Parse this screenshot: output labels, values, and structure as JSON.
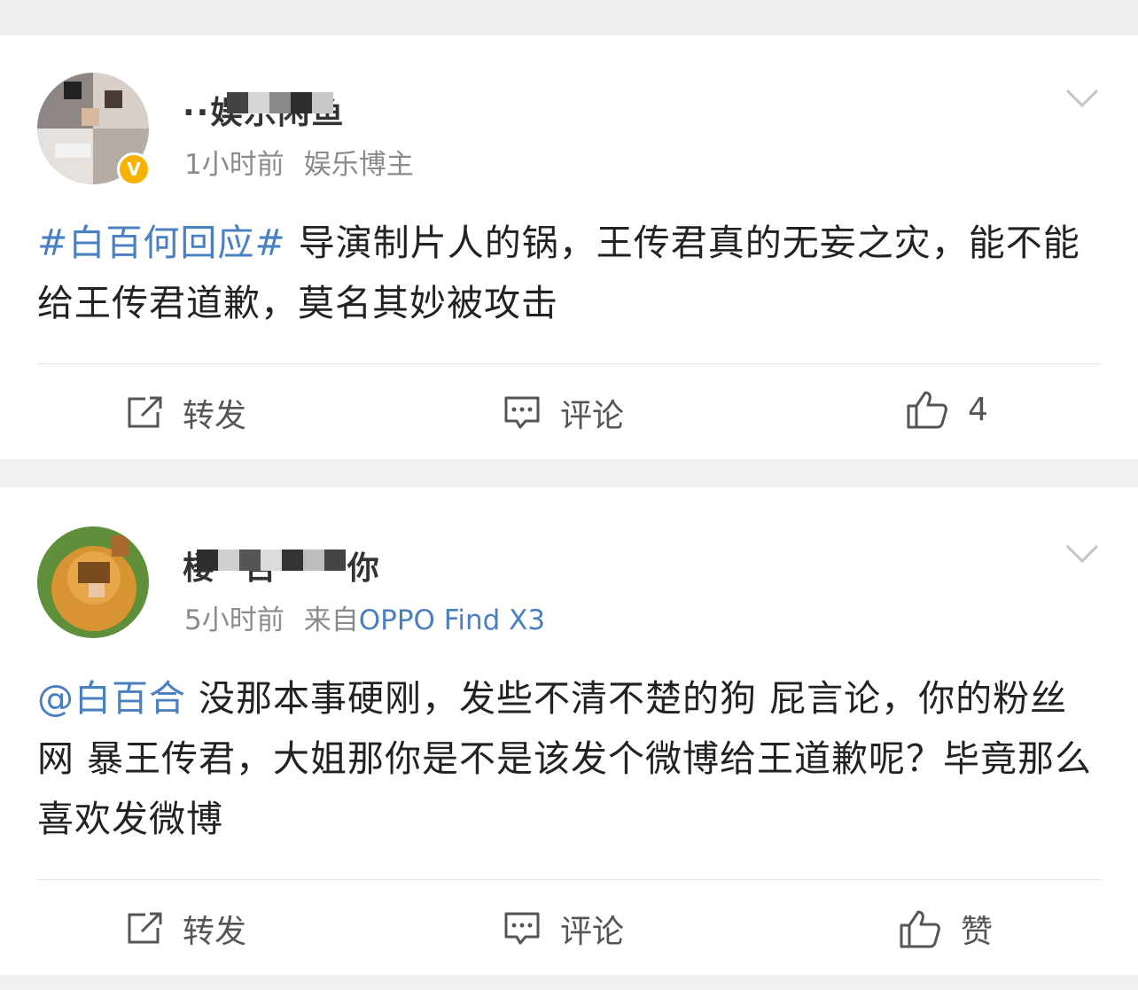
{
  "posts": [
    {
      "username": "··娱乐闲鱼",
      "time": "1小时前",
      "source": "娱乐博主",
      "source_prefix": "",
      "content_tag": "#白百何回应#",
      "content_text": " 导演制片人的锅，王传君真的无妄之灾，能不能给王传君道歉，莫名其妙被攻击",
      "actions": {
        "repost": "转发",
        "comment": "评论",
        "like": "4"
      },
      "verified": true
    },
    {
      "username": "楼··百·····你",
      "time": "5小时前",
      "source_prefix": "来自",
      "source": "OPPO Find X3",
      "content_tag": "@白百合",
      "content_text": " 没那本事硬刚，发些不清不楚的狗 屁言论，你的粉丝网 暴王传君，大姐那你是不是该发个微博给王道歉呢？毕竟那么喜欢发微博",
      "actions": {
        "repost": "转发",
        "comment": "评论",
        "like": "赞"
      },
      "verified": false
    }
  ],
  "colors": {
    "link": "#4a7fc1",
    "meta": "#8b8b8b",
    "badge": "#f7b100"
  },
  "icons": [
    "repost-icon",
    "comment-icon",
    "like-icon",
    "chevron-down-icon",
    "verified-badge-icon"
  ]
}
